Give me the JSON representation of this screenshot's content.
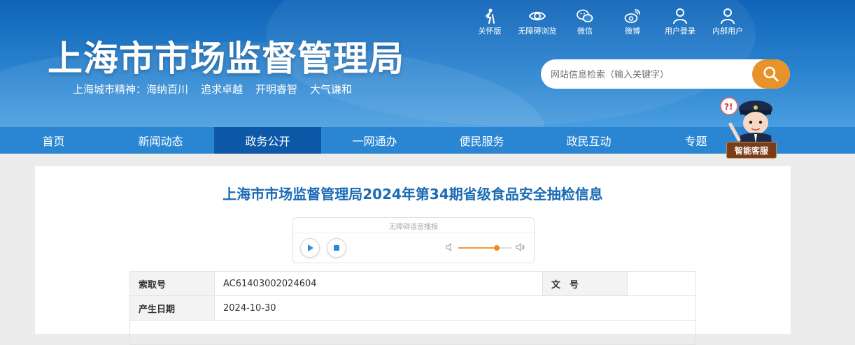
{
  "header": {
    "title": "上海市市场监督管理局",
    "slogan": [
      "上海城市精神：海纳百川",
      "追求卓越",
      "开明睿智",
      "大气谦和"
    ],
    "tools": [
      {
        "label": "关怀版",
        "icon": "elderly-care-icon"
      },
      {
        "label": "无障碍浏览",
        "icon": "eye-icon"
      },
      {
        "label": "微信",
        "icon": "wechat-icon"
      },
      {
        "label": "微博",
        "icon": "weibo-icon"
      },
      {
        "label": "用户登录",
        "icon": "user-icon"
      },
      {
        "label": "内部用户",
        "icon": "user-icon"
      }
    ],
    "search": {
      "placeholder": "网站信息检索（输入关键字）",
      "icon": "search-icon"
    }
  },
  "nav": {
    "items": [
      "首页",
      "新闻动态",
      "政务公开",
      "一网通办",
      "便民服务",
      "政民互动",
      "专题"
    ],
    "active": "政务公开"
  },
  "assistant": {
    "label": "智能客服"
  },
  "article": {
    "title": "上海市市场监督管理局2024年第34期省级食品安全抽检信息",
    "player": {
      "label": "无障碍语音播报",
      "volume": 0.72
    }
  },
  "meta": {
    "index_label": "索取号",
    "index_value": "AC61403002024604",
    "docno_label": "文　号",
    "docno_value": "",
    "date_label": "产生日期",
    "date_value": "2024-10-30"
  },
  "colors": {
    "brand_blue": "#1a6bb5",
    "nav_blue": "#2a86d3",
    "accent_orange": "#e8922a"
  }
}
